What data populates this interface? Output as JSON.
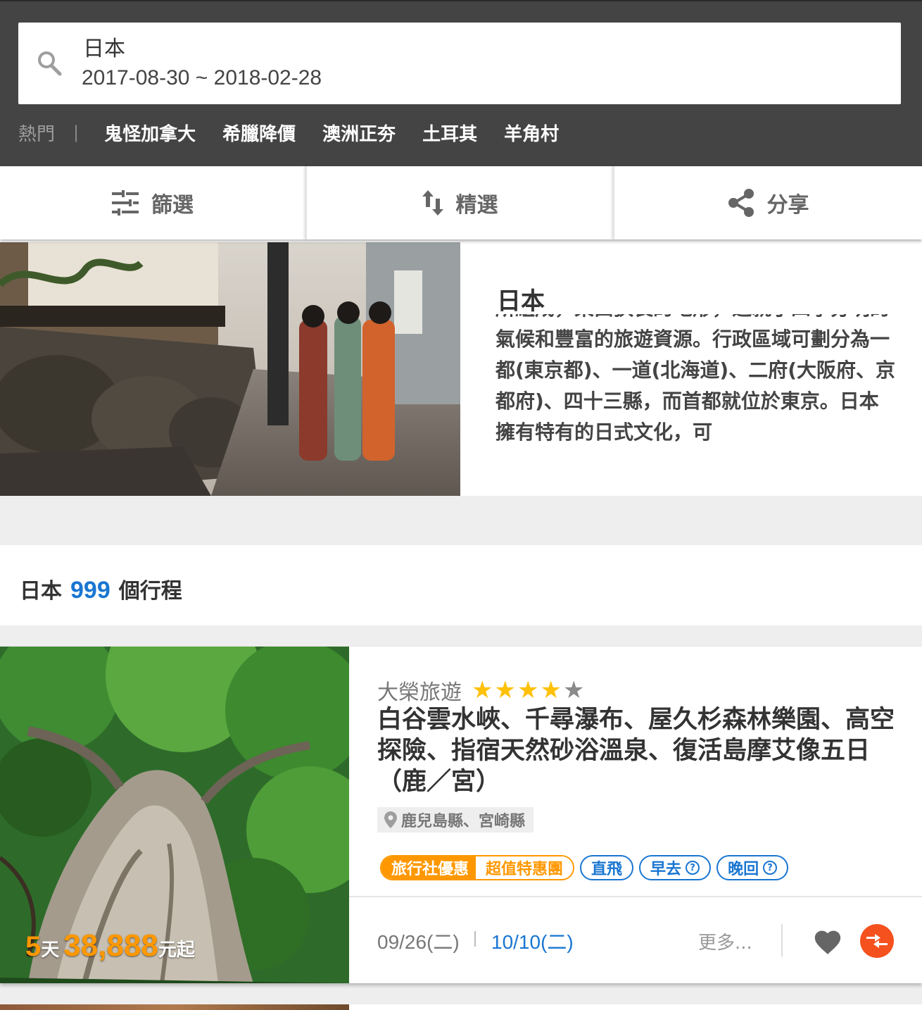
{
  "search": {
    "destination": "日本",
    "date_range": "2017-08-30 ~ 2018-02-28"
  },
  "hot": {
    "label": "熱門",
    "separator": "|",
    "items": [
      "鬼怪加拿大",
      "希臘降價",
      "澳洲正夯",
      "土耳其",
      "羊角村"
    ]
  },
  "toolbar": {
    "filter_label": "篩選",
    "sort_label": "精選",
    "share_label": "分享"
  },
  "intro": {
    "title": "日本",
    "text": "所組成，東西狹長的地形，造就了四季分明的氣候和豐富的旅遊資源。行政區域可劃分為一都(東京都)、一道(北海道)、二府(大阪府、京都府)、四十三縣，而首都就位於東京。日本擁有特有的日式文化，可"
  },
  "results": {
    "destination": "日本",
    "count": "999",
    "suffix": "個行程"
  },
  "tour": {
    "agency": "大榮旅遊",
    "rating": 4,
    "rating_max": 5,
    "title": "白谷雲水峽、千尋瀑布、屋久杉森林樂園、高空探險、指宿天然砂浴溫泉、復活島摩艾像五日（鹿／宮）",
    "location": "鹿兒島縣、宮崎縣",
    "tags": {
      "combo_left": "旅行社優惠",
      "combo_right": "超值特惠團",
      "direct": "直飛",
      "early": "早去",
      "late": "晚回",
      "help_symbol": "?"
    },
    "days_num": "5",
    "days_unit": "天",
    "price": "38,888",
    "price_suffix": "元起",
    "date_1": "09/26(二)",
    "date_2": "10/10(二)",
    "more_label": "更多..."
  },
  "colors": {
    "header_bg": "#444444",
    "accent_blue": "#1976d2",
    "accent_orange": "#ff9800",
    "compare_red": "#f4511e"
  },
  "icons": [
    "search-icon",
    "filter-icon",
    "sort-icon",
    "share-icon",
    "location-pin-icon",
    "heart-icon",
    "compare-icon",
    "help-icon"
  ]
}
